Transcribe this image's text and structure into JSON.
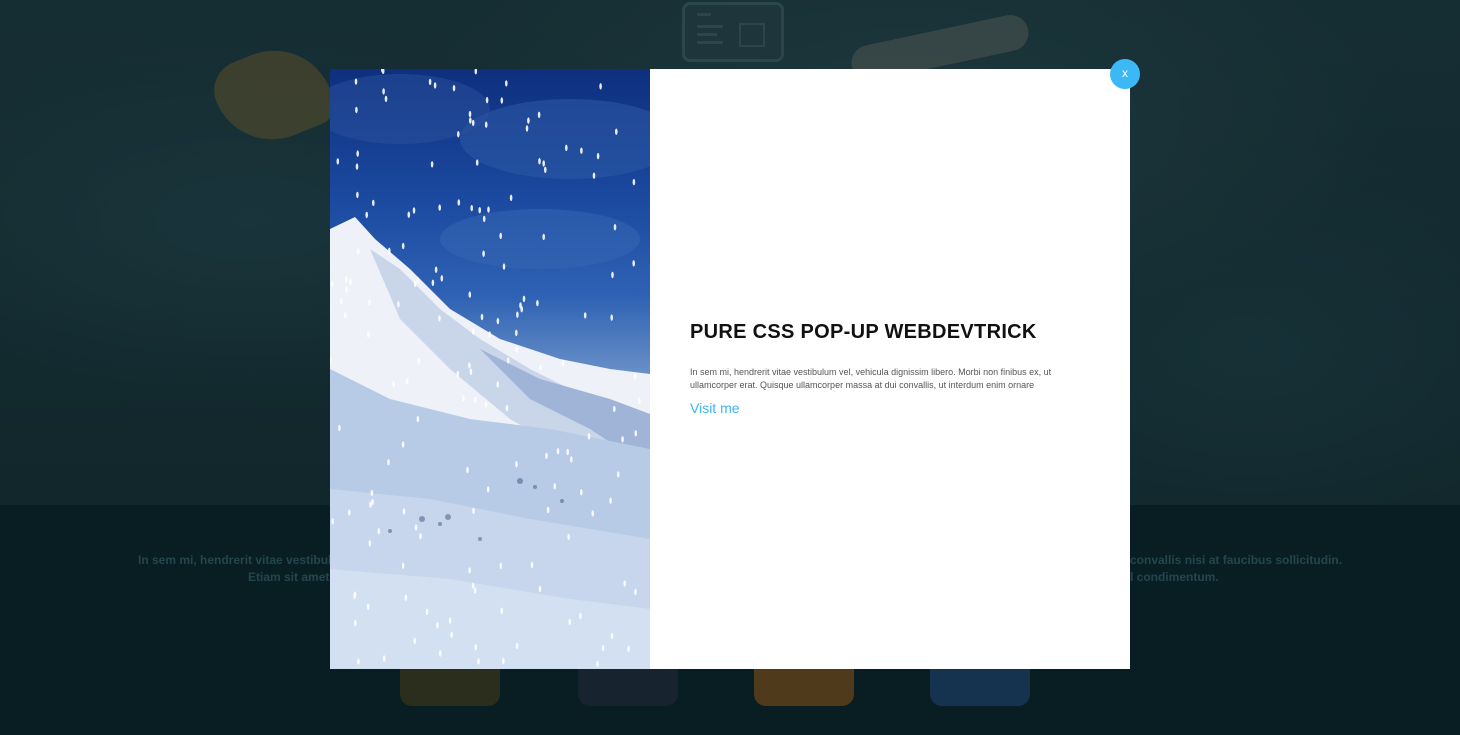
{
  "background": {
    "text_left": [
      "In sem mi, hendrerit vitae vestibulum",
      "Etiam sit amet e"
    ],
    "text_right": [
      "convallis nisi at faucibus sollicitudin.",
      "l condimentum."
    ]
  },
  "popup": {
    "title": "PURE CSS POP-UP WEBDEVTRICK",
    "description": "In sem mi, hendrerit vitae vestibulum vel, vehicula dignissim libero. Morbi non finibus ex, ut ullamcorper erat. Quisque ullamcorper massa at dui convallis, ut interdum enim ornare",
    "link_label": "Visit me",
    "close_label": "x",
    "image_icon": "snowy-mountain-image"
  },
  "colors": {
    "accent": "#3cb8f6",
    "link": "#3cb5f5",
    "title": "#111111"
  }
}
